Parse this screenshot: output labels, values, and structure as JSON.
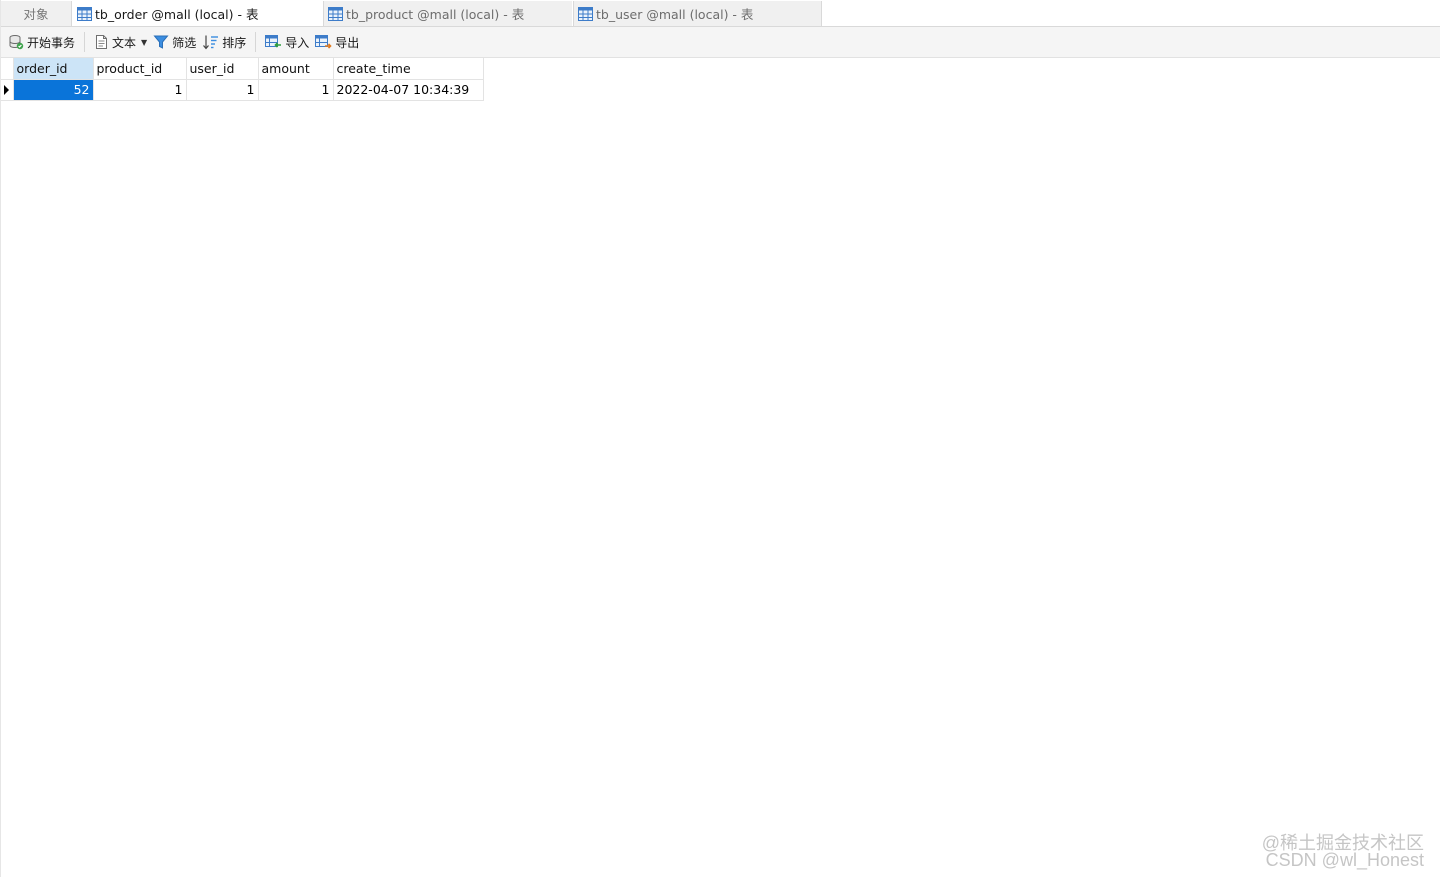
{
  "tabs": [
    {
      "label": "对象",
      "icon": null
    },
    {
      "label": "tb_order @mall (local) - 表",
      "icon": "table-icon",
      "active": true
    },
    {
      "label": "tb_product @mall (local) - 表",
      "icon": "table-icon"
    },
    {
      "label": "tb_user @mall (local) - 表",
      "icon": "table-icon"
    }
  ],
  "toolbar": {
    "begin_transaction": {
      "label": "开始事务",
      "icon": "database-transaction-icon"
    },
    "text": {
      "label": "文本",
      "icon": "document-icon"
    },
    "filter": {
      "label": "筛选",
      "icon": "filter-icon"
    },
    "sort": {
      "label": "排序",
      "icon": "sort-icon"
    },
    "import": {
      "label": "导入",
      "icon": "import-icon"
    },
    "export": {
      "label": "导出",
      "icon": "export-icon"
    }
  },
  "grid": {
    "columns": [
      "order_id",
      "product_id",
      "user_id",
      "amount",
      "create_time"
    ],
    "rows": [
      [
        "52",
        "1",
        "1",
        "1",
        "2022-04-07 10:34:39"
      ]
    ]
  },
  "watermark": {
    "line1": "@稀土掘金技术社区",
    "line2": "CSDN @wl_Honest"
  },
  "colors": {
    "selection": "#0a74d9",
    "header_selection": "#cce4f7",
    "toolbar_bg": "#f5f5f5"
  }
}
